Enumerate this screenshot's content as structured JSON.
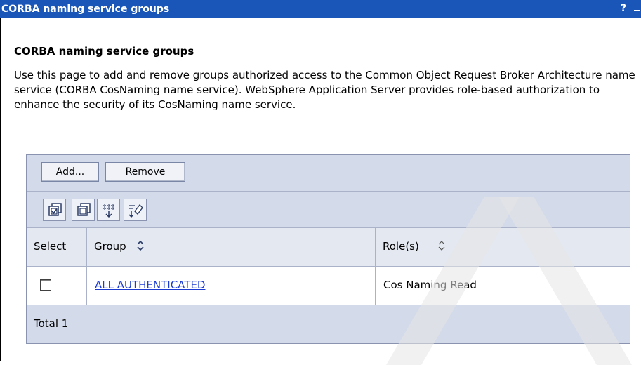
{
  "window": {
    "title": "CORBA naming service groups",
    "help_label": "?"
  },
  "page": {
    "heading": "CORBA naming service groups",
    "description": "Use this page to add and remove groups authorized access to the Common Object Request Broker Architecture name service (CORBA CosNaming name service). WebSphere Application Server provides role-based authorization to enhance the security of its CosNaming name service."
  },
  "toolbar": {
    "add_label": "Add...",
    "remove_label": "Remove"
  },
  "icon_toolbar": {
    "icons": [
      "select-all-icon",
      "deselect-all-icon",
      "show-filter-icon",
      "clear-filter-icon"
    ]
  },
  "table": {
    "columns": {
      "select": "Select",
      "group": "Group",
      "roles": "Role(s)"
    },
    "rows": [
      {
        "group": "ALL AUTHENTICATED",
        "roles": "Cos Naming Read",
        "selected": false
      }
    ],
    "total": "Total 1"
  },
  "colors": {
    "title_bar": "#1a56b8",
    "panel_bg": "#d3dae9",
    "link": "#1b3bd1"
  }
}
